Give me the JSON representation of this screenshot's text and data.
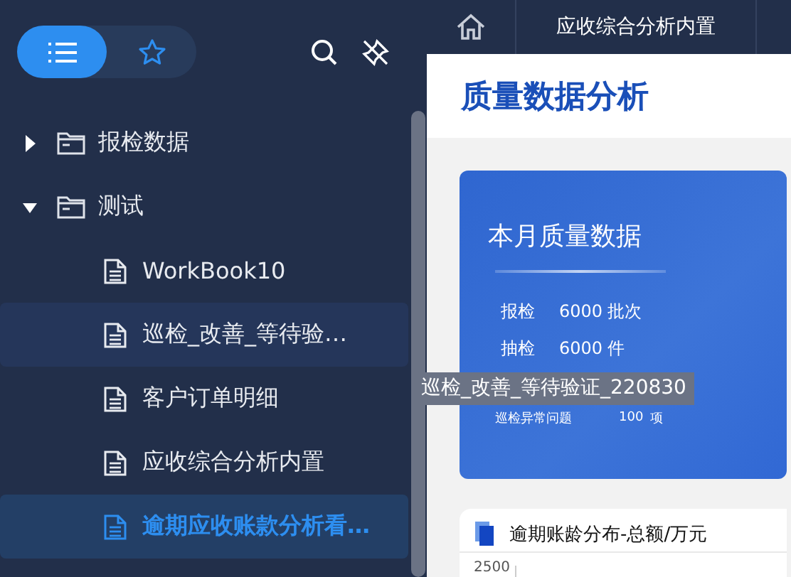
{
  "sidebar": {
    "view_toggle": [
      {
        "kind": "list",
        "selected": true
      },
      {
        "kind": "favorites",
        "selected": false
      }
    ],
    "tree": [
      {
        "label": "报检数据",
        "expanded": false
      },
      {
        "label": "测试",
        "expanded": true,
        "children": [
          {
            "label": "WorkBook10",
            "selected": false,
            "hovered": false
          },
          {
            "label": "巡检_改善_等待验…",
            "selected": false,
            "hovered": true
          },
          {
            "label": "客户订单明细",
            "selected": false,
            "hovered": false
          },
          {
            "label": "应收综合分析内置",
            "selected": false,
            "hovered": false
          },
          {
            "label": "逾期应收账款分析看…",
            "selected": true,
            "hovered": false
          }
        ]
      }
    ]
  },
  "tabs": [
    {
      "label": "应收综合分析内置",
      "selected": true
    }
  ],
  "page_title": "质量数据分析",
  "summary_card": {
    "title": "本月质量数据",
    "stats": [
      {
        "kind": "large",
        "label": "报检",
        "value": "6000",
        "unit": "批次"
      },
      {
        "kind": "large",
        "label": "抽检",
        "value": "6000",
        "unit": "件"
      },
      {
        "kind": "small",
        "label": "巡检异常问题",
        "value": "100",
        "unit": "项"
      }
    ]
  },
  "chart_card": {
    "title": "逾期账龄分布-总额/万元",
    "y_tick_label": "2500"
  },
  "tooltip": "巡检_改善_等待验证_220830"
}
